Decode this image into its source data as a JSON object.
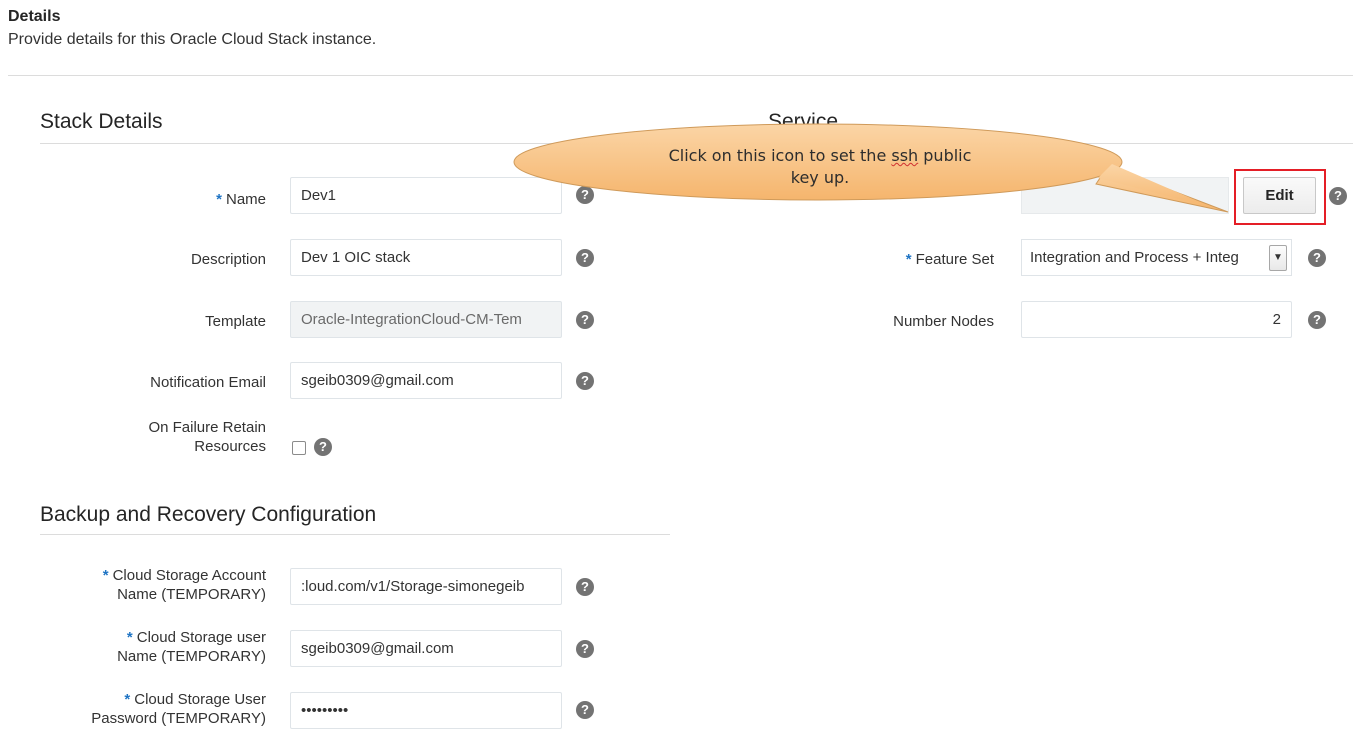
{
  "header": {
    "title": "Details",
    "subtitle": "Provide details for this Oracle Cloud Stack instance."
  },
  "stack_details": {
    "title": "Stack Details",
    "required_marker": "*",
    "name": {
      "label": "Name",
      "value": "Dev1"
    },
    "description": {
      "label": "Description",
      "value": "Dev 1 OIC stack"
    },
    "template": {
      "label": "Template",
      "value": "Oracle-IntegrationCloud-CM-Tem"
    },
    "notification_email": {
      "label": "Notification Email",
      "value": "sgeib0309@gmail.com"
    },
    "on_failure": {
      "label_line1": "On Failure Retain",
      "label_line2": "Resources",
      "checked": false
    }
  },
  "service": {
    "title": "Service",
    "edit_label": "Edit",
    "feature_set": {
      "label": "Feature Set",
      "value": "Integration and Process + Integ"
    },
    "number_nodes": {
      "label": "Number Nodes",
      "value": "2"
    }
  },
  "backup": {
    "title": "Backup and Recovery Configuration",
    "account": {
      "label_line1": "Cloud Storage Account",
      "label_line2": "Name (TEMPORARY)",
      "value": ":loud.com/v1/Storage-simonegeib"
    },
    "user": {
      "label_line1": "Cloud Storage user",
      "label_line2": "Name (TEMPORARY)",
      "value": "sgeib0309@gmail.com"
    },
    "password": {
      "label_line1": "Cloud Storage User",
      "label_line2": "Password (TEMPORARY)",
      "value": "•••••••••"
    }
  },
  "callout": {
    "line1_pre": "Click on this icon to set the ",
    "line1_ssh": "ssh",
    "line1_post": " public",
    "line2": "key up."
  },
  "help_glyph": "?",
  "colors": {
    "required": "#1f74c4",
    "highlight": "#e41e26",
    "callout_fill": "#f9c58a",
    "help": "#737373"
  }
}
